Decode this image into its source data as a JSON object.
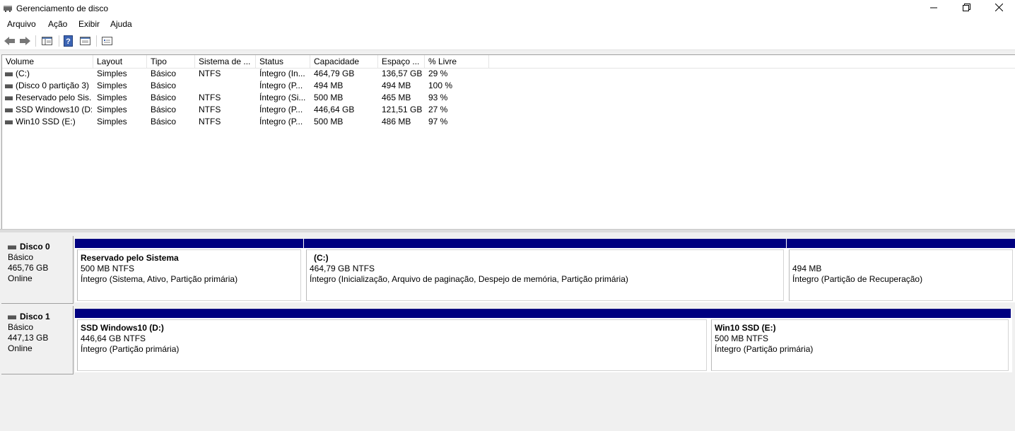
{
  "window": {
    "title": "Gerenciamento de disco"
  },
  "menu": [
    "Arquivo",
    "Ação",
    "Exibir",
    "Ajuda"
  ],
  "volumes": {
    "columns": [
      "Volume",
      "Layout",
      "Tipo",
      "Sistema de ...",
      "Status",
      "Capacidade",
      "Espaço ...",
      "% Livre"
    ],
    "rows": [
      {
        "volume": " (C:)",
        "layout": "Simples",
        "tipo": "Básico",
        "fs": "NTFS",
        "status": "Íntegro (In...",
        "capacidade": "464,79 GB",
        "espaco": "136,57 GB",
        "livre": "29 %"
      },
      {
        "volume": "(Disco 0 partição 3)",
        "layout": "Simples",
        "tipo": "Básico",
        "fs": "",
        "status": "Íntegro (P...",
        "capacidade": "494 MB",
        "espaco": "494 MB",
        "livre": "100 %"
      },
      {
        "volume": "Reservado pelo Sis...",
        "layout": "Simples",
        "tipo": "Básico",
        "fs": "NTFS",
        "status": "Íntegro (Si...",
        "capacidade": "500 MB",
        "espaco": "465 MB",
        "livre": "93 %"
      },
      {
        "volume": "SSD Windows10 (D:)",
        "layout": "Simples",
        "tipo": "Básico",
        "fs": "NTFS",
        "status": "Íntegro (P...",
        "capacidade": "446,64 GB",
        "espaco": "121,51 GB",
        "livre": "27 %"
      },
      {
        "volume": "Win10 SSD (E:)",
        "layout": "Simples",
        "tipo": "Básico",
        "fs": "NTFS",
        "status": "Íntegro (P...",
        "capacidade": "500 MB",
        "espaco": "486 MB",
        "livre": "97 %"
      }
    ]
  },
  "disks": [
    {
      "name": "Disco 0",
      "type": "Básico",
      "size": "465,76 GB",
      "state": "Online",
      "partitions": [
        {
          "name": "Reservado pelo Sistema",
          "size": "500 MB NTFS",
          "status": "Íntegro (Sistema, Ativo, Partição primária)"
        },
        {
          "name": "(C:)",
          "size": "464,79 GB NTFS",
          "status": "Íntegro (Inicialização, Arquivo de paginação, Despejo de memória, Partição primária)"
        },
        {
          "name": "",
          "size": "494 MB",
          "status": "Íntegro (Partição de Recuperação)"
        }
      ]
    },
    {
      "name": "Disco 1",
      "type": "Básico",
      "size": "447,13 GB",
      "state": "Online",
      "partitions": [
        {
          "name": "SSD Windows10  (D:)",
          "size": "446,64 GB NTFS",
          "status": "Íntegro (Partição primária)"
        },
        {
          "name": "Win10 SSD  (E:)",
          "size": "500 MB NTFS",
          "status": "Íntegro (Partição primária)"
        }
      ]
    }
  ],
  "colors": {
    "partition_bar": "#000080"
  },
  "icons": [
    "app-disk-icon",
    "minimize-icon",
    "restore-icon",
    "close-icon",
    "back-arrow-icon",
    "forward-arrow-icon",
    "console-tree-icon",
    "help-icon",
    "properties-icon",
    "settings-icon",
    "volume-icon",
    "disk-icon"
  ]
}
